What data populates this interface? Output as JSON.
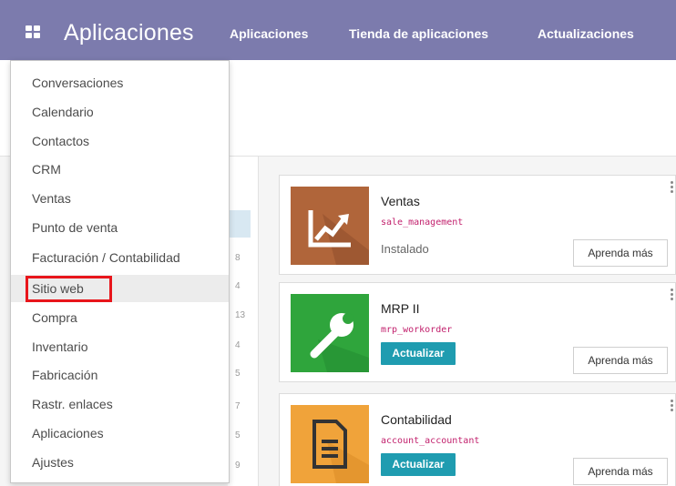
{
  "navbar": {
    "brand": "Aplicaciones",
    "links": [
      "Aplicaciones",
      "Tienda de aplicaciones",
      "Actualizaciones"
    ]
  },
  "menu": {
    "items": [
      "Conversaciones",
      "Calendario",
      "Contactos",
      "CRM",
      "Ventas",
      "Punto de venta",
      "Facturación / Contabilidad",
      "Sitio web",
      "Compra",
      "Inventario",
      "Fabricación",
      "Rastr. enlaces",
      "Aplicaciones",
      "Ajustes"
    ],
    "highlighted": "Sitio web"
  },
  "side_counts": [
    "8",
    "4",
    "13",
    "4",
    "5",
    "7",
    "5",
    "9"
  ],
  "apps": [
    {
      "name": "Ventas",
      "technical_name": "sale_management",
      "status": "Instalado",
      "learn_more": "Aprenda más",
      "icon": "chart-trend-icon",
      "color": "#b0653a"
    },
    {
      "name": "MRP II",
      "technical_name": "mrp_workorder",
      "action": "Actualizar",
      "learn_more": "Aprenda más",
      "icon": "wrench-icon",
      "color": "#2fa53c"
    },
    {
      "name": "Contabilidad",
      "technical_name": "account_accountant",
      "action": "Actualizar",
      "learn_more": "Aprenda más",
      "icon": "document-icon",
      "color": "#f0a33a"
    }
  ],
  "colors": {
    "navbar": "#7c7bad",
    "primary_button": "#1f9cb0",
    "highlight": "#e8151b",
    "tech_name": "#c2216d"
  }
}
